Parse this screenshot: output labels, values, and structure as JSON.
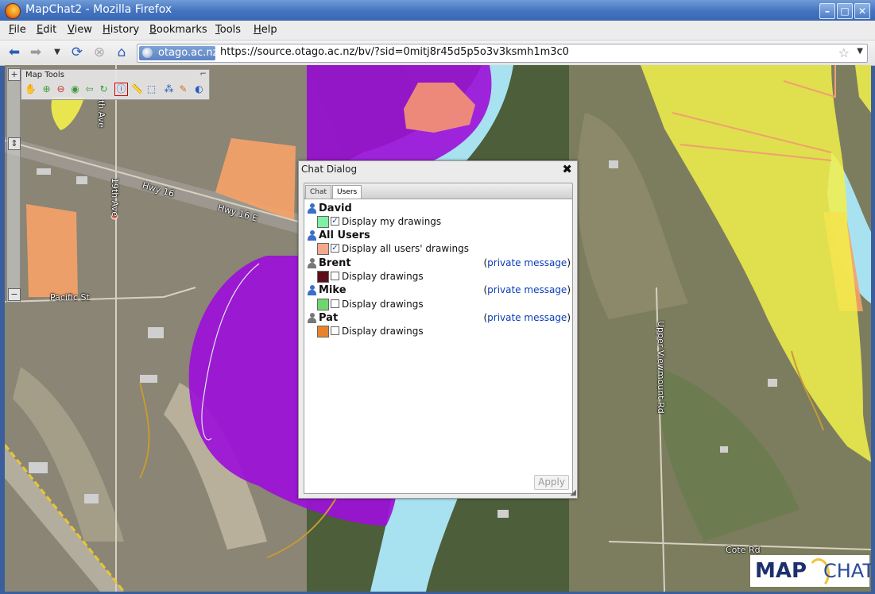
{
  "window": {
    "title": "MapChat2 - Mozilla Firefox"
  },
  "menu": [
    "File",
    "Edit",
    "View",
    "History",
    "Bookmarks",
    "Tools",
    "Help"
  ],
  "nav": {
    "identity": "otago.ac.nz",
    "url": "https://source.otago.ac.nz/bv/?sid=0mitj8r45d5p5o3v3ksmh1m3c0"
  },
  "map": {
    "labels": {
      "nineteenth_ave_a": "19th Ave",
      "nineteenth_ave_b": "19th Ave",
      "hwy16": "Hwy 16",
      "hwy16e": "Hwy 16 E",
      "pacific": "Pacific St",
      "upper_viewmount": "Upper Viewmount Rd",
      "cote": "Cote Rd"
    },
    "tools_title": "Map Tools"
  },
  "dialog": {
    "title": "Chat Dialog",
    "tabs": [
      "Chat",
      "Users"
    ],
    "active_tab": "Users",
    "users": [
      {
        "name": "David",
        "label": "Display my drawings",
        "checked": true,
        "color": "#7ff0a4",
        "pm": ""
      },
      {
        "name": "All Users",
        "label": "Display all users' drawings",
        "checked": true,
        "color": "#f4a98a",
        "pm": ""
      },
      {
        "name": "Brent",
        "label": "Display drawings",
        "checked": false,
        "color": "#5c0f1a",
        "pm": "private message"
      },
      {
        "name": "Mike",
        "label": "Display drawings",
        "checked": false,
        "color": "#6fd66f",
        "pm": "private message"
      },
      {
        "name": "Pat",
        "label": "Display drawings",
        "checked": false,
        "color": "#e8832c",
        "pm": "private message"
      }
    ],
    "apply": "Apply"
  },
  "logo": {
    "left": "MAP",
    "right": "CHAT"
  }
}
